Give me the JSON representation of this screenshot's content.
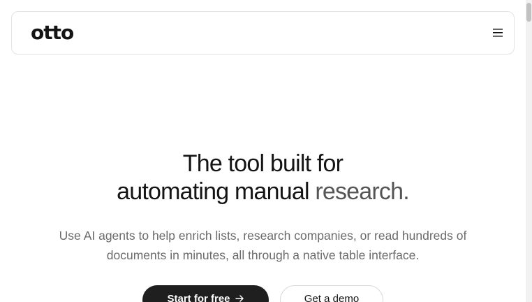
{
  "header": {
    "logo_text": "otto",
    "menu_icon": "hamburger-menu-icon"
  },
  "hero": {
    "title_line1": "The tool built for",
    "title_line2_main": "automating manual ",
    "title_line2_accent": "research.",
    "subtitle": "Use AI agents to help enrich lists, research companies, or read hundreds of documents in minutes, all through a native table interface."
  },
  "cta": {
    "primary_label": "Start for free",
    "primary_icon": "arrow-right-icon",
    "secondary_label": "Get a demo"
  },
  "colors": {
    "text": "#141414",
    "muted_text": "#6b6b6b",
    "primary_button": "#1f1f1f",
    "border": "#e3e3e3"
  }
}
